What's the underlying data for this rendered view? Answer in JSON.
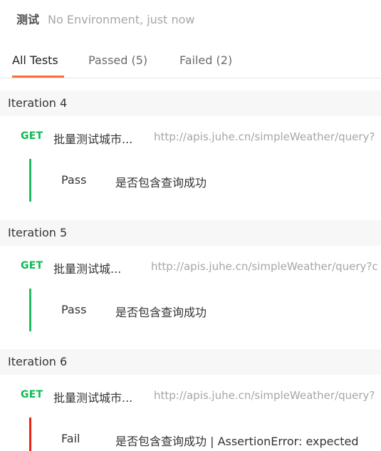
{
  "header": {
    "collection_name": "测试",
    "meta": "No Environment, just now"
  },
  "tabs": [
    {
      "label": "All Tests",
      "active": true
    },
    {
      "label": "Passed (5)",
      "active": false
    },
    {
      "label": "Failed (2)",
      "active": false
    }
  ],
  "iterations": [
    {
      "title": "Iteration 4",
      "request": {
        "method": "GET",
        "name": "批量测试城市...",
        "url": "http://apis.juhe.cn/simpleWeather/query?"
      },
      "result": {
        "status": "Pass",
        "description": "是否包含查询成功"
      }
    },
    {
      "title": "Iteration 5",
      "request": {
        "method": "GET",
        "name": "批量测试城...",
        "url": "http://apis.juhe.cn/simpleWeather/query?c"
      },
      "result": {
        "status": "Pass",
        "description": "是否包含查询成功"
      }
    },
    {
      "title": "Iteration 6",
      "request": {
        "method": "GET",
        "name": "批量测试城市...",
        "url": "http://apis.juhe.cn/simpleWeather/query?"
      },
      "result": {
        "status": "Fail",
        "description": "是否包含查询成功 | AssertionError: expected"
      }
    }
  ],
  "colors": {
    "accent": "#ff6c37",
    "get_method": "#0cbb52",
    "pass": "#21bd60",
    "fail": "#eb2013"
  }
}
